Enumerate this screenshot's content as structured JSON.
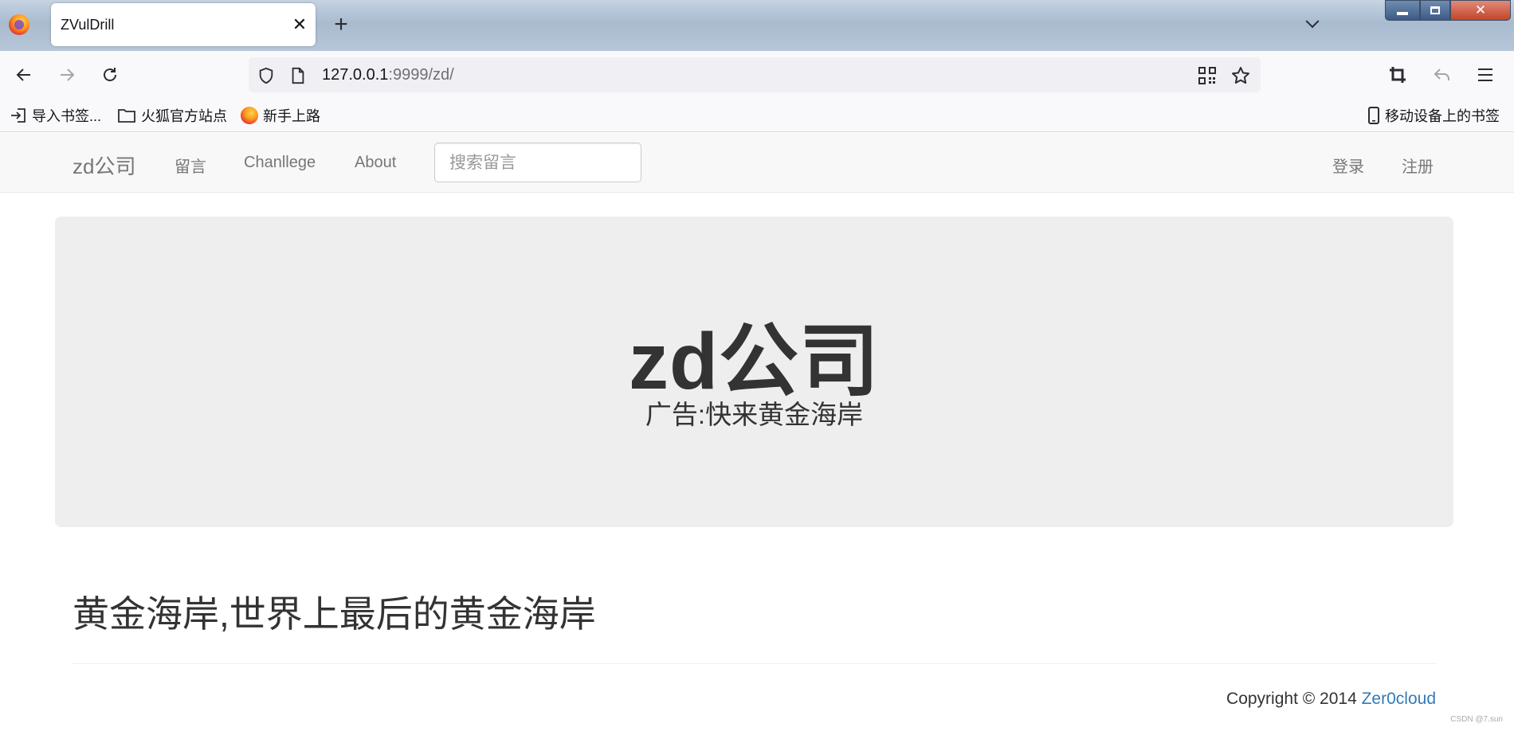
{
  "browser": {
    "tab_title": "ZVulDrill",
    "tab_close": "✕",
    "new_tab": "+",
    "url_host": "127.0.0.1",
    "url_rest": ":9999/zd/",
    "bookmarks": [
      {
        "label": "导入书签..."
      },
      {
        "label": "火狐官方站点"
      },
      {
        "label": "新手上路"
      }
    ],
    "mobile_bookmarks": "移动设备上的书签"
  },
  "site": {
    "brand": "zd公司",
    "nav": {
      "guestbook": "留言",
      "challenge": "Chanllege",
      "about": "About"
    },
    "search_placeholder": "搜索留言",
    "login": "登录",
    "register": "注册",
    "jumbotron": {
      "title": "zd公司",
      "subtitle": "广告:快来黄金海岸"
    },
    "headline": "黄金海岸,世界上最后的黄金海岸",
    "footer": {
      "copyright": "Copyright © 2014",
      "author": "Zer0cloud"
    },
    "watermark": "CSDN @7.sun"
  }
}
